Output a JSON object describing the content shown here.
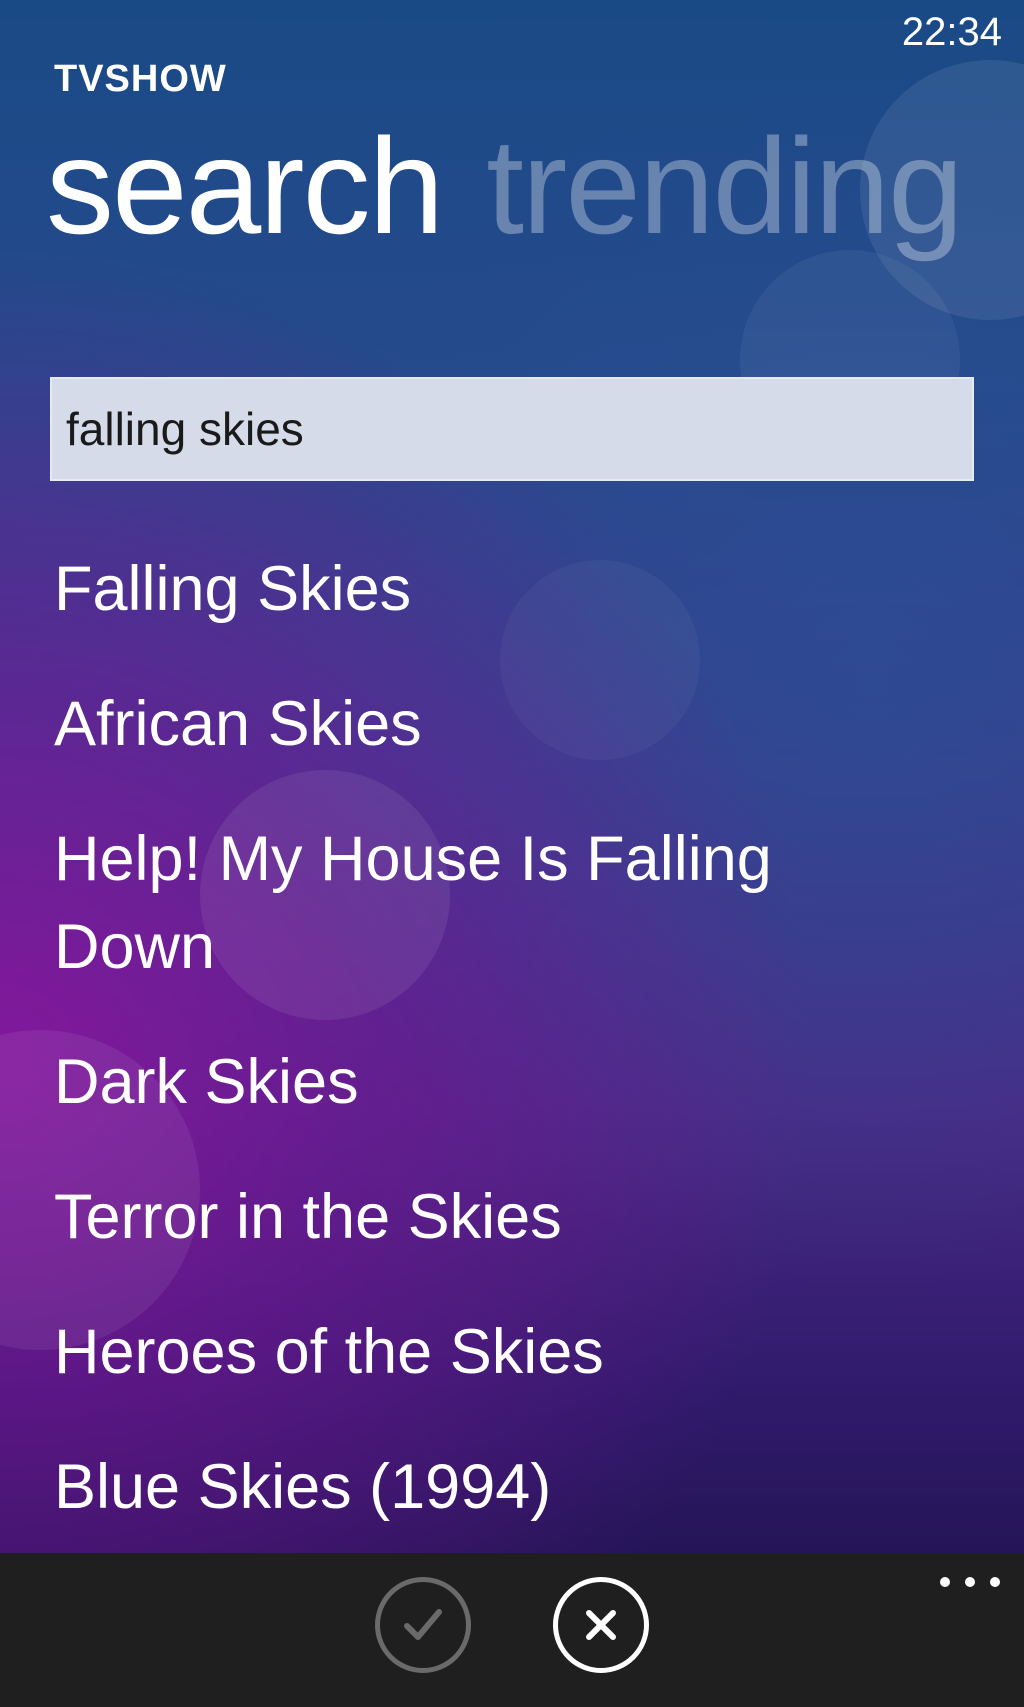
{
  "status_bar": {
    "time": "22:34"
  },
  "header": {
    "app_title": "TVSHOW"
  },
  "pivot": {
    "tabs": [
      {
        "label": "search",
        "active": true
      },
      {
        "label": "trending",
        "active": false
      }
    ]
  },
  "search": {
    "value": "falling skies",
    "placeholder": ""
  },
  "results": [
    "Falling Skies",
    "African Skies",
    "Help! My House Is Falling Down",
    "Dark Skies",
    "Terror in the Skies",
    "Heroes of the Skies",
    "Blue Skies (1994)"
  ],
  "app_bar": {
    "buttons": [
      {
        "icon": "check-icon",
        "enabled": false
      },
      {
        "icon": "close-icon",
        "enabled": true
      }
    ],
    "more_icon": "more-ellipsis-icon"
  },
  "colors": {
    "background_top": "#1a4a86",
    "background_accent": "#8c14a0",
    "search_box": "#d5dbe8",
    "app_bar": "#1f1f1f",
    "inactive_tab": "rgba(255,255,255,0.32)"
  }
}
